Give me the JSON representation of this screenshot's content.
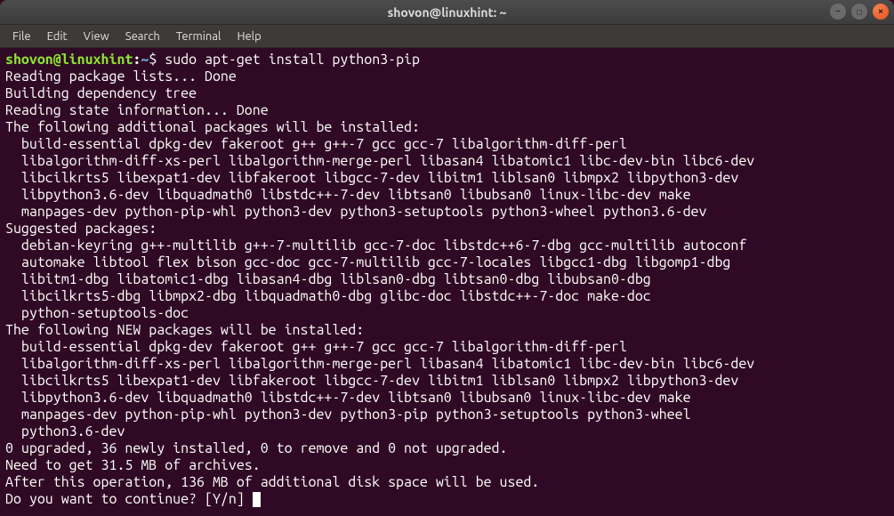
{
  "window": {
    "title": "shovon@linuxhint: ~"
  },
  "menubar": {
    "items": [
      "File",
      "Edit",
      "View",
      "Search",
      "Terminal",
      "Help"
    ]
  },
  "prompt": {
    "user_host": "shovon@linuxhint",
    "separator": ":",
    "path": "~",
    "symbol": "$"
  },
  "command": "sudo apt-get install python3-pip",
  "output_lines": [
    "Reading package lists... Done",
    "Building dependency tree",
    "Reading state information... Done",
    "The following additional packages will be installed:",
    "  build-essential dpkg-dev fakeroot g++ g++-7 gcc gcc-7 libalgorithm-diff-perl",
    "  libalgorithm-diff-xs-perl libalgorithm-merge-perl libasan4 libatomic1 libc-dev-bin libc6-dev",
    "  libcilkrts5 libexpat1-dev libfakeroot libgcc-7-dev libitm1 liblsan0 libmpx2 libpython3-dev",
    "  libpython3.6-dev libquadmath0 libstdc++-7-dev libtsan0 libubsan0 linux-libc-dev make",
    "  manpages-dev python-pip-whl python3-dev python3-setuptools python3-wheel python3.6-dev",
    "Suggested packages:",
    "  debian-keyring g++-multilib g++-7-multilib gcc-7-doc libstdc++6-7-dbg gcc-multilib autoconf",
    "  automake libtool flex bison gcc-doc gcc-7-multilib gcc-7-locales libgcc1-dbg libgomp1-dbg",
    "  libitm1-dbg libatomic1-dbg libasan4-dbg liblsan0-dbg libtsan0-dbg libubsan0-dbg",
    "  libcilkrts5-dbg libmpx2-dbg libquadmath0-dbg glibc-doc libstdc++-7-doc make-doc",
    "  python-setuptools-doc",
    "The following NEW packages will be installed:",
    "  build-essential dpkg-dev fakeroot g++ g++-7 gcc gcc-7 libalgorithm-diff-perl",
    "  libalgorithm-diff-xs-perl libalgorithm-merge-perl libasan4 libatomic1 libc-dev-bin libc6-dev",
    "  libcilkrts5 libexpat1-dev libfakeroot libgcc-7-dev libitm1 liblsan0 libmpx2 libpython3-dev",
    "  libpython3.6-dev libquadmath0 libstdc++-7-dev libtsan0 libubsan0 linux-libc-dev make",
    "  manpages-dev python-pip-whl python3-dev python3-pip python3-setuptools python3-wheel",
    "  python3.6-dev",
    "0 upgraded, 36 newly installed, 0 to remove and 0 not upgraded.",
    "Need to get 31.5 MB of archives.",
    "After this operation, 136 MB of additional disk space will be used.",
    "Do you want to continue? [Y/n] "
  ]
}
